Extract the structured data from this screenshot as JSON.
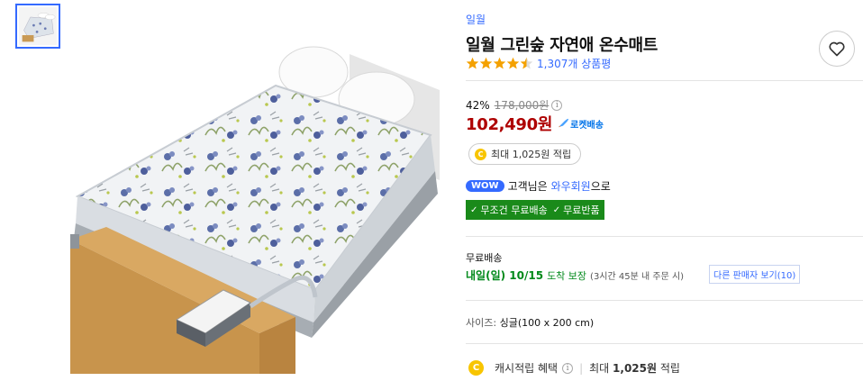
{
  "gallery": {
    "thumbnail_alt": "mattress-thumbnail",
    "main_alt": "mattress-main-image"
  },
  "product": {
    "brand": "일월",
    "title": "일월 그린숲 자연애 온수매트",
    "rating_stars": 4.5,
    "review_count": "1,307개 상품평"
  },
  "price": {
    "discount_rate": "42%",
    "original_price": "178,000원",
    "info_icon": "i",
    "sale_price": "102,490원",
    "rocket_label": "로켓배송"
  },
  "points": {
    "coin_letter": "C",
    "max_points": "최대 1,025원 적립"
  },
  "wow": {
    "badge": "WOW",
    "text_before": "고객님은",
    "link": "와우회원",
    "text_after": "으로"
  },
  "free_bar": {
    "check": "✓",
    "item1": "무조건 무료배송",
    "item2": "무료반품"
  },
  "shipping": {
    "title": "무료배송",
    "date": "내일(일) 10/15",
    "guarantee": "도착 보장",
    "note": "(3시간 45분 내 주문 시)",
    "other_sellers": "다른 판매자 보기(10)"
  },
  "option": {
    "label": "사이즈:",
    "value": "싱글(100 x 200 cm)"
  },
  "cash": {
    "coin_letter": "C",
    "label": "캐시적립 혜택",
    "info_icon": "i",
    "separator": "|",
    "amount_prefix": "최대",
    "amount": "1,025원",
    "amount_suffix": "적립"
  },
  "colors": {
    "accent_blue": "#346aff",
    "price_red": "#ae0000",
    "green": "#1a8a1a",
    "star_orange": "#f4a100"
  }
}
